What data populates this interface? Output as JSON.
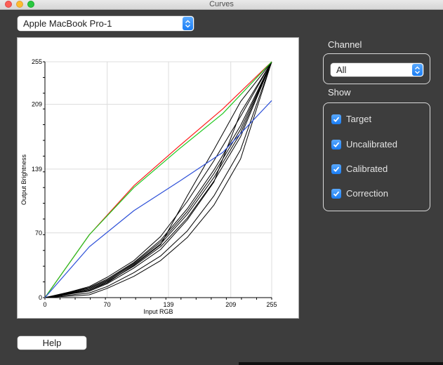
{
  "window": {
    "title": "Curves"
  },
  "display_select": {
    "value": "Apple MacBook Pro-1"
  },
  "channel": {
    "label": "Channel",
    "value": "All"
  },
  "show": {
    "label": "Show",
    "options": [
      {
        "label": "Target",
        "checked": true
      },
      {
        "label": "Uncalibrated",
        "checked": true
      },
      {
        "label": "Calibrated",
        "checked": true
      },
      {
        "label": "Correction",
        "checked": true
      }
    ]
  },
  "help_button": {
    "label": "Help"
  },
  "colors": {
    "accent": "#1a7df4",
    "target_red": "#ff1a1a",
    "target_green": "#1ec81e",
    "uncalibrated_blue": "#2c4fd8"
  },
  "chart_data": {
    "type": "line",
    "xlabel": "Input RGB",
    "ylabel": "Output Brightness",
    "xlim": [
      0,
      255
    ],
    "ylim": [
      0,
      255
    ],
    "x_ticks": [
      "0",
      "70",
      "139",
      "209",
      "255"
    ],
    "y_ticks": [
      "0",
      "70",
      "139",
      "209",
      "255"
    ],
    "grid": true,
    "series": [
      {
        "color": "#ff1a1a",
        "points": [
          [
            0,
            0
          ],
          [
            50,
            68
          ],
          [
            100,
            121
          ],
          [
            150,
            163
          ],
          [
            200,
            204
          ],
          [
            255,
            255
          ]
        ]
      },
      {
        "color": "#1ec81e",
        "points": [
          [
            0,
            0
          ],
          [
            50,
            68
          ],
          [
            100,
            119
          ],
          [
            150,
            160
          ],
          [
            200,
            199
          ],
          [
            255,
            255
          ]
        ]
      },
      {
        "color": "#2c4fd8",
        "points": [
          [
            0,
            0
          ],
          [
            50,
            55
          ],
          [
            100,
            94
          ],
          [
            150,
            125
          ],
          [
            200,
            157
          ],
          [
            255,
            213
          ]
        ]
      },
      {
        "color": "#000000",
        "points": [
          [
            0,
            0
          ],
          [
            50,
            9
          ],
          [
            70,
            18
          ],
          [
            100,
            36
          ],
          [
            130,
            58
          ],
          [
            160,
            90
          ],
          [
            190,
            130
          ],
          [
            220,
            178
          ],
          [
            255,
            255
          ]
        ]
      },
      {
        "color": "#000000",
        "points": [
          [
            0,
            0
          ],
          [
            50,
            10
          ],
          [
            70,
            19
          ],
          [
            100,
            37
          ],
          [
            130,
            60
          ],
          [
            160,
            93
          ],
          [
            190,
            134
          ],
          [
            220,
            182
          ],
          [
            255,
            255
          ]
        ]
      },
      {
        "color": "#000000",
        "points": [
          [
            0,
            0
          ],
          [
            50,
            8
          ],
          [
            70,
            17
          ],
          [
            100,
            34
          ],
          [
            130,
            55
          ],
          [
            160,
            86
          ],
          [
            190,
            126
          ],
          [
            220,
            174
          ],
          [
            255,
            255
          ]
        ]
      },
      {
        "color": "#000000",
        "points": [
          [
            0,
            0
          ],
          [
            50,
            11
          ],
          [
            70,
            20
          ],
          [
            100,
            38
          ],
          [
            130,
            62
          ],
          [
            160,
            96
          ],
          [
            190,
            138
          ],
          [
            220,
            186
          ],
          [
            255,
            255
          ]
        ]
      },
      {
        "color": "#000000",
        "points": [
          [
            0,
            0
          ],
          [
            50,
            5
          ],
          [
            70,
            12
          ],
          [
            100,
            27
          ],
          [
            130,
            45
          ],
          [
            160,
            72
          ],
          [
            190,
            110
          ],
          [
            220,
            160
          ],
          [
            255,
            255
          ]
        ]
      },
      {
        "color": "#000000",
        "points": [
          [
            0,
            0
          ],
          [
            50,
            3
          ],
          [
            70,
            10
          ],
          [
            100,
            23
          ],
          [
            130,
            40
          ],
          [
            160,
            65
          ],
          [
            190,
            100
          ],
          [
            220,
            150
          ],
          [
            255,
            255
          ]
        ]
      },
      {
        "color": "#000000",
        "points": [
          [
            0,
            0
          ],
          [
            20,
            4
          ],
          [
            50,
            12
          ],
          [
            70,
            22
          ],
          [
            100,
            40
          ],
          [
            130,
            66
          ],
          [
            160,
            104
          ],
          [
            190,
            148
          ],
          [
            220,
            196
          ],
          [
            255,
            255
          ]
        ]
      },
      {
        "color": "#000000",
        "points": [
          [
            0,
            0
          ],
          [
            50,
            7
          ],
          [
            70,
            15
          ],
          [
            100,
            32
          ],
          [
            130,
            52
          ],
          [
            160,
            84
          ],
          [
            190,
            125
          ],
          [
            220,
            200
          ],
          [
            255,
            255
          ]
        ]
      },
      {
        "color": "#000000",
        "points": [
          [
            0,
            0
          ],
          [
            50,
            8
          ],
          [
            70,
            16
          ],
          [
            100,
            35
          ],
          [
            130,
            57
          ],
          [
            160,
            110
          ],
          [
            190,
            160
          ],
          [
            220,
            212
          ],
          [
            255,
            255
          ]
        ]
      }
    ]
  }
}
